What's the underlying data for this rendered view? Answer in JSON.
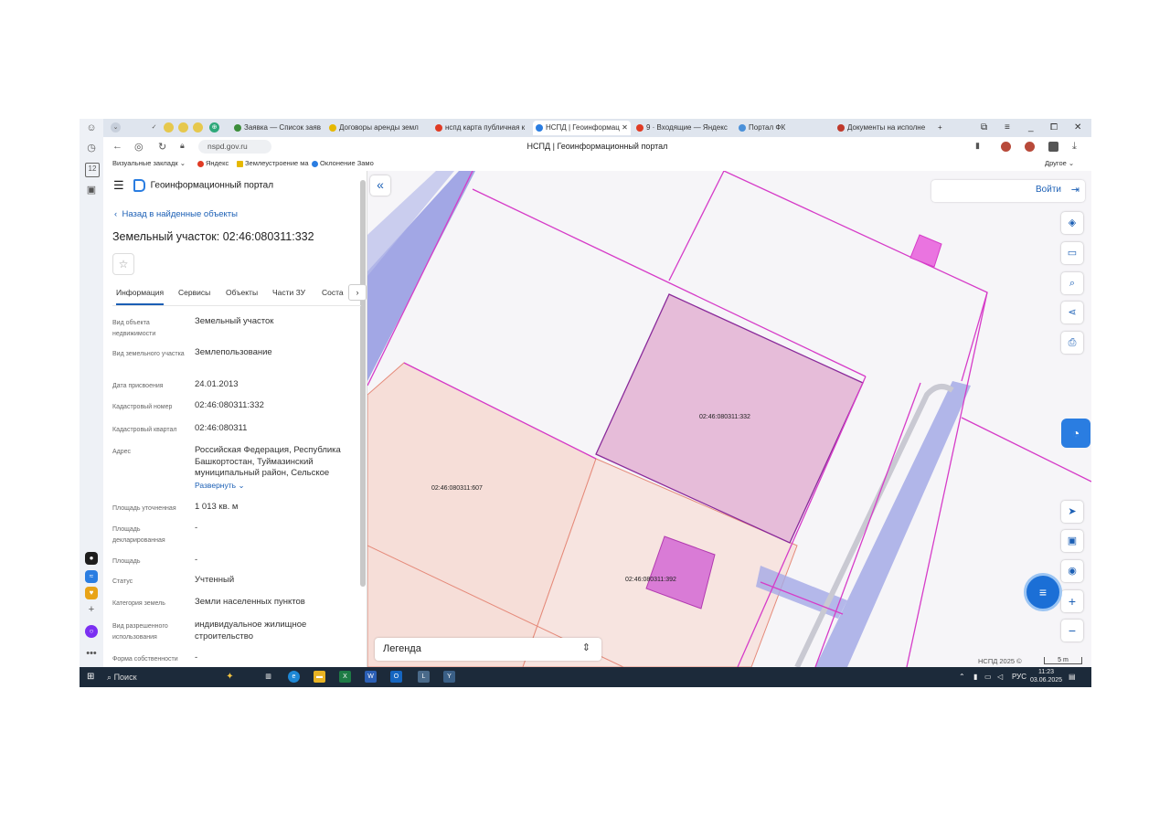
{
  "browser": {
    "tabs": [
      {
        "title": "Заявка — Список заяв",
        "color": "#3c8d3a",
        "glyph": "M"
      },
      {
        "title": "Договоры аренды земл",
        "color": "#e6b800",
        "glyph": ""
      },
      {
        "title": "нспд карта публичная к",
        "color": "#e03b24",
        "glyph": ""
      },
      {
        "title": "НСПД | Геоинформац",
        "color": "#2a7de1",
        "glyph": ""
      },
      {
        "title": "9 · Входящие — Яндекс",
        "color": "#e03b24",
        "glyph": ""
      },
      {
        "title": "Портал ФК",
        "color": "#4a90d9",
        "glyph": ""
      },
      {
        "title": "Документы на исполне",
        "color": "#c0392b",
        "glyph": ""
      }
    ],
    "tab_close": "✕",
    "new_tab": "+",
    "url": "nspd.gov.ru",
    "page_title": "НСПД | Геоинформационный портал",
    "rail_badge": "12",
    "bookmarks": {
      "visual": "Визуальные закладк",
      "yandex": "Яндекс",
      "zem": "Землеустроение ма",
      "okl": "Оклонение Замо",
      "other": "Другое"
    }
  },
  "panel": {
    "header_title": "Геоинформационный портал",
    "back_link": "Назад в найденные объекты",
    "title": "Земельный участок: 02:46:080311:332",
    "tabs": [
      "Информация",
      "Сервисы",
      "Объекты",
      "Части ЗУ",
      "Соста"
    ],
    "next": "›",
    "fields": [
      {
        "label": "Вид объекта недвижимости",
        "value": "Земельный участок"
      },
      {
        "label": "Вид земельного участка",
        "value": "Землепользование"
      },
      {
        "label": "Дата присвоения",
        "value": "24.01.2013"
      },
      {
        "label": "Кадастровый номер",
        "value": "02:46:080311:332"
      },
      {
        "label": "Кадастровый квартал",
        "value": "02:46:080311"
      },
      {
        "label": "Адрес",
        "value": "Российская Федерация, Республика Башкортостан, Туймазинский муниципальный район, Сельское",
        "link": "Развернуть"
      },
      {
        "label": "Площадь уточненная",
        "value": "1 013 кв. м"
      },
      {
        "label": "Площадь декларированная",
        "value": "-"
      },
      {
        "label": "Площадь",
        "value": "-"
      },
      {
        "label": "Статус",
        "value": "Учтенный"
      },
      {
        "label": "Категория земель",
        "value": "Земли населенных пунктов"
      },
      {
        "label": "Вид разрешенного использования",
        "value": "индивидуальное жилищное строительство"
      },
      {
        "label": "Форма собственности",
        "value": "-"
      }
    ]
  },
  "map": {
    "login_label": "Войти",
    "legend_label": "Легенда",
    "labels": [
      "02:46:080311:332",
      "02:46:080311:607",
      "02:46:080311:392"
    ],
    "copyright": "НСПД 2025 ©",
    "scale": "5 m",
    "colors": {
      "parcel_border": "#d63cc8",
      "selected_fill": "#e6bcd9",
      "neighbor_fill": "#f7e1dc",
      "road": "#8d94e0",
      "accent": "#1b5fb5"
    }
  },
  "taskbar": {
    "search": "Поиск",
    "lang": "РУС",
    "time": "11:23",
    "date": "03.06.2025"
  }
}
